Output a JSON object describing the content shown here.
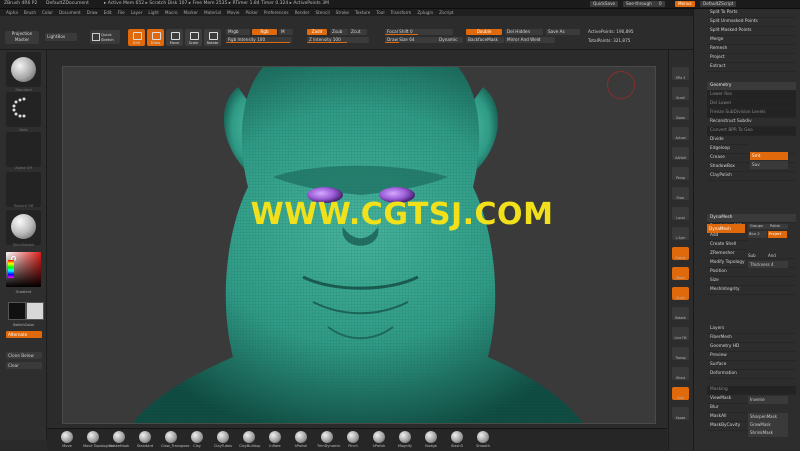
{
  "titlebar": {
    "app": "ZBrush 4R6 P2",
    "doc": "DefaultZDocument",
    "mem": "▸ Active Mem 652 ▸ Scratch Disk 107 ▸ Free Mem 2535 ▸ RTimer 1.84 Timer 0.324 ▸ ActivePoints 3M",
    "quicksave": "QuickSave",
    "seethrough": "See-through",
    "seethrough_val": "0",
    "menus_label": "Menus",
    "script": "DefaultZScript"
  },
  "menus": [
    "Alpha",
    "Brush",
    "Color",
    "Document",
    "Draw",
    "Edit",
    "File",
    "Layer",
    "Light",
    "Macro",
    "Marker",
    "Material",
    "Movie",
    "Picker",
    "Preferences",
    "Render",
    "Stencil",
    "Stroke",
    "Texture",
    "Tool",
    "Transform",
    "Zplugin",
    "Zscript"
  ],
  "topshelf": {
    "projection_master": "Projection Master",
    "lightbox": "LightBox",
    "quick_sketch": "Quick Sketch",
    "tools": [
      {
        "label": "Edit",
        "on": true
      },
      {
        "label": "Draw",
        "on": true
      },
      {
        "label": "Move",
        "on": false
      },
      {
        "label": "Scale",
        "on": false
      },
      {
        "label": "Rotate",
        "on": false
      }
    ],
    "mrgb": "Mrgb",
    "rgb": "Rgb",
    "m": "M",
    "zadd": "Zadd",
    "zsub": "Zsub",
    "zcut": "Zcut",
    "rgb_intensity": "Rgb Intensity 100",
    "z_intensity": "Z Intensity 100",
    "focal_shift": "Focal Shift 0",
    "draw_size": "Draw Size 64",
    "dynamic": "Dynamic",
    "double": "Double",
    "del_hidden": "Del Hidden",
    "save_as": "Save As",
    "backface_mask": "BackfaceMask",
    "mirror_weld": "Mirror And Weld",
    "active_points": "ActivePoints: 190,895",
    "total_points": "TotalPoints: 321,875"
  },
  "leftshelf": {
    "labels": [
      "Standard",
      "Dots",
      "Alpha Off",
      "Texture Off",
      "SkinShade4"
    ],
    "gradient": "Gradient",
    "switch_color": "SwitchColor",
    "alternate": "Alternate",
    "clear_below": "Clone Below",
    "clear": "Clear"
  },
  "watermark": "WWW.CGTSJ.COM",
  "rightshelf": [
    "SPix 3",
    "Scroll",
    "Zoom",
    "Actual",
    "AAHalf",
    "Persp",
    "Floor",
    "Local",
    "L.Sym",
    "Frame",
    "Move",
    "Scale",
    "Rotate",
    "Line Fill",
    "Transp",
    "Ghost",
    "Solo",
    "Xpose"
  ],
  "rightpal": {
    "items": [
      {
        "label": "Split To Parts",
        "type": "normal"
      },
      {
        "label": "Split Unmasked Points",
        "type": "normal"
      },
      {
        "label": "Split Masked Points",
        "type": "normal"
      },
      {
        "label": "Merge",
        "type": "normal"
      },
      {
        "label": "Remesh",
        "type": "normal"
      },
      {
        "label": "Project",
        "type": "normal"
      },
      {
        "label": "Extract",
        "type": "normal"
      },
      {
        "label": "Geometry",
        "type": "hdr"
      },
      {
        "label": "Lower Res",
        "type": "dark"
      },
      {
        "label": "Del Lower",
        "type": "dark"
      },
      {
        "label": "Freeze SubDivision Levels",
        "type": "dark"
      },
      {
        "label": "Reconstruct Subdiv",
        "type": "normal"
      },
      {
        "label": "Convert BPR To Geo",
        "type": "dark"
      },
      {
        "label": "Divide",
        "type": "normal"
      },
      {
        "label": "Edgeloop",
        "type": "normal"
      },
      {
        "label": "Crease",
        "type": "normal"
      },
      {
        "label": "ShadowBox",
        "type": "normal"
      },
      {
        "label": "ClayPolish",
        "type": "normal"
      },
      {
        "label": "DynaMesh",
        "type": "hdr"
      },
      {
        "label": "Resolution 192",
        "type": "normal"
      },
      {
        "label": "Add",
        "type": "normal"
      },
      {
        "label": "Create Shell",
        "type": "normal"
      },
      {
        "label": "ZRemesher",
        "type": "normal"
      },
      {
        "label": "Modify Topology",
        "type": "normal"
      },
      {
        "label": "Position",
        "type": "normal"
      },
      {
        "label": "Size",
        "type": "normal"
      },
      {
        "label": "MeshIntegrity",
        "type": "normal"
      },
      {
        "label": "Layers",
        "type": "normal"
      },
      {
        "label": "FiberMesh",
        "type": "normal"
      },
      {
        "label": "Geometry HD",
        "type": "normal"
      },
      {
        "label": "Preview",
        "type": "normal"
      },
      {
        "label": "Surface",
        "type": "normal"
      },
      {
        "label": "Deformation",
        "type": "normal"
      },
      {
        "label": "Masking",
        "type": "dark"
      },
      {
        "label": "ViewMask",
        "type": "normal"
      },
      {
        "label": "Blur",
        "type": "normal"
      },
      {
        "label": "MaskAll",
        "type": "normal"
      },
      {
        "label": "MaskByCavity",
        "type": "normal"
      }
    ],
    "dynamesh_btn": "DynaMesh",
    "groups": "Groups",
    "polish": "Polish",
    "blur": "Blur 2",
    "project": "Project",
    "sub": "Sub",
    "and": "And",
    "thickness": "Thickness 4",
    "smt": "Smt",
    "suv": "Suv",
    "inverse": "Inverse",
    "mask_lasso": "SharpenMask",
    "grow_mask": "GrowMask",
    "shrink_mask": "ShrinkMask"
  },
  "brushes": [
    "Move",
    "Move Topological",
    "SnakeHook",
    "Standard",
    "Claw_Transpose",
    "Clay",
    "ClayTubes",
    "ClayBuildup",
    "Inflate",
    "hPolish",
    "TrimDynamic",
    "Pinch",
    "hPolish",
    "Magnify",
    "Nudge",
    "Slash3",
    "Smooth"
  ],
  "colors": {
    "accent": "#e0690c",
    "skin": "#2f9b86",
    "eye": "#9a5cd6",
    "watermark": "#f2e11a"
  }
}
